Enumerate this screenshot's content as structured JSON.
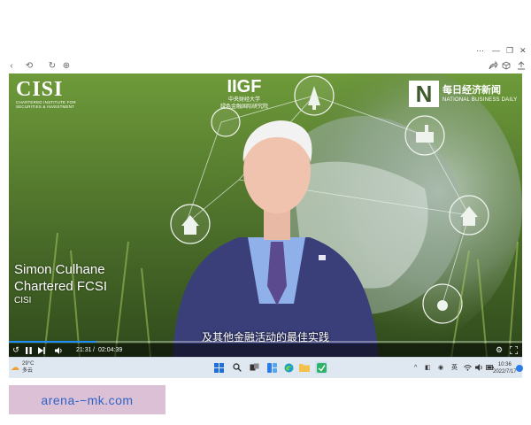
{
  "browser": {
    "window_controls": [
      "⋯",
      "—",
      "❐",
      "✕"
    ],
    "toolbar_left": [
      "‹",
      "⟲",
      "↻",
      "⊕"
    ],
    "toolbar_right": [
      "share-icon",
      "cube-icon",
      "download-icon"
    ]
  },
  "video": {
    "logos": {
      "cisi_big": "CISI",
      "cisi_small": "CHARTERED INSTITUTE FOR SECURITIES & INVESTMENT",
      "iigf_big": "IIGF",
      "iigf_small1": "中央财经大学",
      "iigf_small2": "绿色金融国际研究院",
      "nbd_mark": "N",
      "nbd_cn": "每日经济新闻",
      "nbd_en": "NATIONAL BUSINESS DAILY"
    },
    "speaker": {
      "name": "Simon Culhane",
      "role": "Chartered FCSI",
      "org": "CISI"
    },
    "subtitle": "及其他金融活动的最佳实践",
    "progress_fraction": 0.17,
    "time_current": "21:31",
    "time_total": "02:04:39"
  },
  "taskbar": {
    "temperature": "29°C",
    "condition": "多云",
    "lang": "英",
    "time": "10:36",
    "date": "2022/7/17"
  },
  "watermark": "arena-−mk.com",
  "colors": {
    "accent": "#1f8cff",
    "taskbar_bg": "#dfe7f0",
    "watermark_bg": "#dcc0d6",
    "watermark_text": "#2e63c7"
  }
}
